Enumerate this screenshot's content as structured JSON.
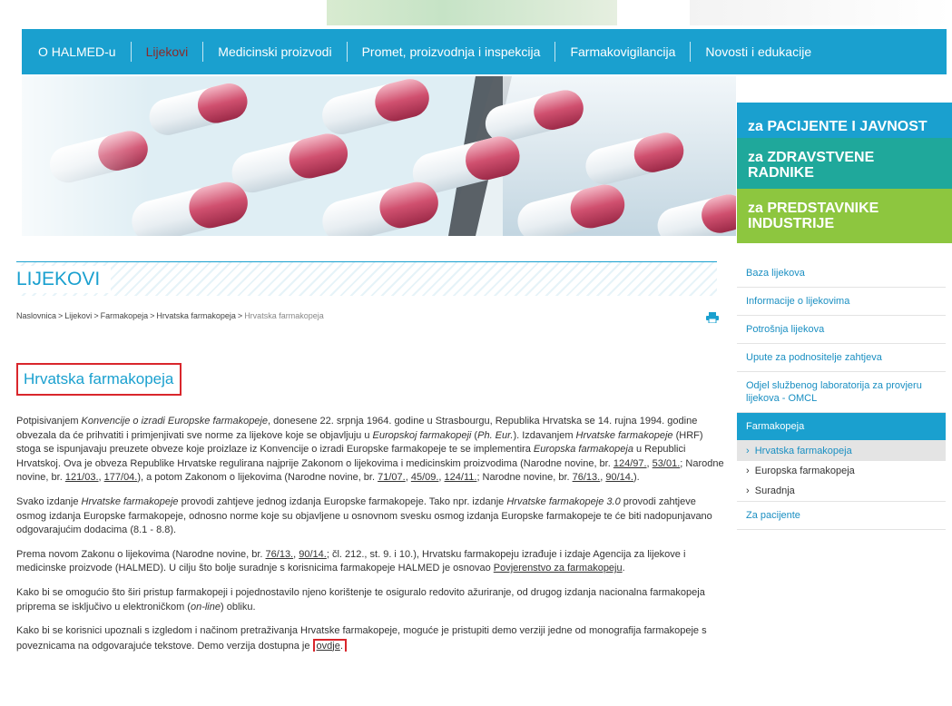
{
  "nav": {
    "items": [
      {
        "label": "O HALMED-u"
      },
      {
        "label": "Lijekovi"
      },
      {
        "label": "Medicinski proizvodi"
      },
      {
        "label": "Promet, proizvodnja i inspekcija"
      },
      {
        "label": "Farmakovigilancija"
      },
      {
        "label": "Novosti i edukacije"
      }
    ],
    "active_color": "#8a2a2a"
  },
  "audience": {
    "patients": "za PACIJENTE I JAVNOST",
    "health_workers_line1": "za ZDRAVSTVENE",
    "health_workers_line2": "RADNIKE",
    "industry_line1": "za PREDSTAVNIKE",
    "industry_line2": "INDUSTRIJE"
  },
  "page": {
    "title": "LIJEKOVI",
    "breadcrumb": [
      "Naslovnica",
      "Lijekovi",
      "Farmakopeja",
      "Hrvatska farmakopeja",
      "Hrvatska farmakopeja"
    ],
    "section_title": "Hrvatska farmakopeja"
  },
  "content": {
    "p1": {
      "t1": "Potpisivanjem ",
      "e1": "Konvencije o izradi Europske farmakopeje",
      "t2": ", donesene 22. srpnja 1964. godine u Strasbourgu, Republika Hrvatska se 14. rujna 1994. godine obvezala da će prihvatiti i primjenjivati sve norme za lijekove koje se objavljuju u ",
      "e2": "Europskoj farmakopeji",
      "t3": " (",
      "e3": "Ph. Eur.",
      "t4": "). Izdavanjem ",
      "e4": "Hrvatske farmakopeje",
      "t5": " (HRF) stoga se ispunjavaju preuzete obveze koje proizlaze iz Konvencije o izradi Europske farmakopeje te se implementira ",
      "e5": "Europska farmakopeja",
      "t6": " u Republici Hrvatskoj. Ova je obveza Republike Hrvatske regulirana najprije Zakonom o lijekovima i medicinskim proizvodima (Narodne novine, br. ",
      "l1": "124/97.",
      "t7": ", ",
      "l2": "53/01.",
      "t8": "; Narodne novine, br. ",
      "l3": "121/03.",
      "t9": ", ",
      "l4": "177/04.",
      "t10": "), a potom Zakonom o lijekovima (Narodne novine, br. ",
      "l5": "71/07.",
      "t11": ", ",
      "l6": "45/09.",
      "t12": ", ",
      "l7": "124/11.",
      "t13": "; Narodne novine, br. ",
      "l8": "76/13.",
      "t14": ", ",
      "l9": "90/14.",
      "t15": ")."
    },
    "p2": {
      "t1": "Svako izdanje ",
      "e1": "Hrvatske farmakopeje",
      "t2": " provodi zahtjeve jednog izdanja Europske farmakopeje. Tako npr. izdanje ",
      "e2": "Hrvatske farmakopeje 3.0",
      "t3": " provodi zahtjeve osmog izdanja Europske farmakopeje, odnosno norme koje su objavljene u osnovnom svesku osmog izdanja Europske farmakopeje te će biti nadopunjavano odgovarajućim dodacima (8.1 - 8.8)."
    },
    "p3": {
      "t1": "Prema novom Zakonu o lijekovima (Narodne novine, br. ",
      "l1": "76/13.",
      "t2": ", ",
      "l2": "90/14.",
      "t3": "; čl. 212., st. 9. i 10.), Hrvatsku farmakopeju izrađuje i izdaje Agencija za lijekove i medicinske proizvode (HALMED). U cilju što bolje suradnje s korisnicima farmakopeje HALMED je osnovao ",
      "l3": "Povjerenstvo za farmakopeju",
      "t4": "."
    },
    "p4": {
      "t1": "Kako bi se omogućio što širi pristup farmakopeji i pojednostavilo njeno korištenje te osiguralo redovito ažuriranje, od drugog izdanja nacionalna farmakopeja priprema se isključivo u elektroničkom (",
      "e1": "on-line",
      "t2": ") obliku."
    },
    "p5": {
      "t1": "Kako bi se korisnici upoznali s izgledom i načinom pretraživanja Hrvatske farmakopeje, moguće je pristupiti demo verziji jedne od monografija farmakopeje s poveznicama na odgovarajuće tekstove. Demo verzija dostupna je ",
      "l1": "ovdje",
      "t2": "."
    }
  },
  "sidebar": {
    "items": [
      "Baza lijekova",
      "Informacije o lijekovima",
      "Potrošnja lijekova",
      "Upute za podnositelje zahtjeva",
      "Odjel službenog laboratorija za provjeru lijekova - OMCL"
    ],
    "section": "Farmakopeja",
    "sub": [
      "Hrvatska farmakopeja",
      "Europska farmakopeja",
      "Suradnja"
    ],
    "last": "Za pacijente"
  },
  "colors": {
    "brand_blue": "#1aa0cf",
    "teal": "#1fa89b",
    "green": "#8dc63f",
    "highlight_red": "#d9262c"
  }
}
